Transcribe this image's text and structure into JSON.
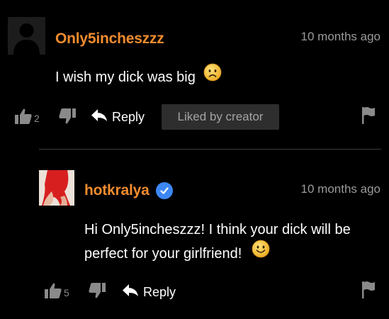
{
  "colors": {
    "username": "#f08c2f",
    "verified_badge": "#3d87f5",
    "icon_gray": "#8a8a8a",
    "badge_bg": "#2e2e2e"
  },
  "comments": [
    {
      "username": "Only5incheszzz",
      "timestamp": "10 months ago",
      "text": "I wish my dick was big",
      "emoji": "sad-face-emoji",
      "likes": "2",
      "reply_label": "Reply",
      "badge": "Liked by creator",
      "avatar": "default-avatar-icon"
    },
    {
      "username": "hotkralya",
      "verified": true,
      "timestamp": "10 months ago",
      "text_line1": "Hi Only5incheszzz! I think your dick will be",
      "text_line2": "perfect for your girlfriend!",
      "emoji": "smile-face-emoji",
      "likes": "5",
      "reply_label": "Reply",
      "avatar": "profile-photo"
    }
  ]
}
